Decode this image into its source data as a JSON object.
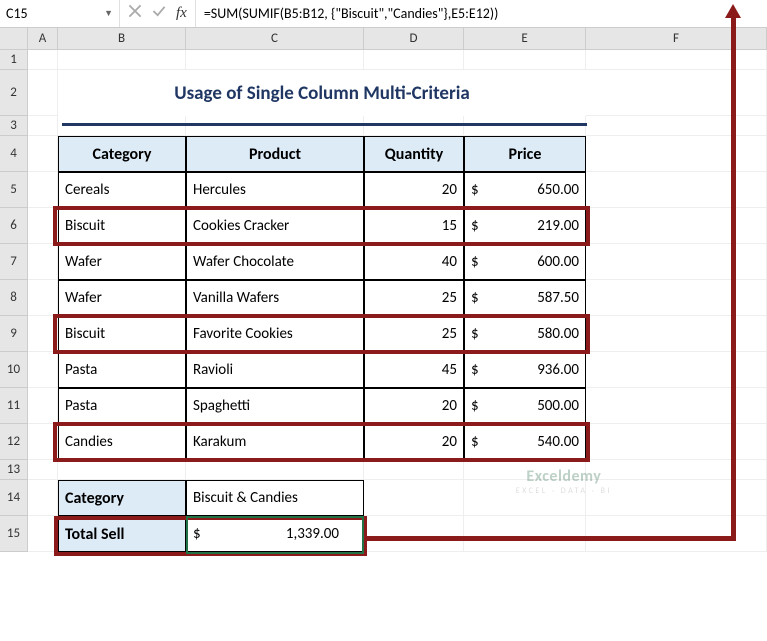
{
  "namebox": "C15",
  "formula": "=SUM(SUMIF(B5:B12, {\"Biscuit\",\"Candies\"},E5:E12))",
  "cols": [
    "A",
    "B",
    "C",
    "D",
    "E",
    "F"
  ],
  "rows": [
    "1",
    "2",
    "3",
    "4",
    "5",
    "6",
    "7",
    "8",
    "9",
    "10",
    "11",
    "12",
    "13",
    "14",
    "15"
  ],
  "title": "Usage of Single Column Multi-Criteria",
  "headers": {
    "cat": "Category",
    "prod": "Product",
    "qty": "Quantity",
    "price": "Price"
  },
  "data": [
    {
      "cat": "Cereals",
      "prod": "Hercules",
      "qty": "20",
      "cur": "$",
      "price": "650.00"
    },
    {
      "cat": "Biscuit",
      "prod": "Cookies Cracker",
      "qty": "15",
      "cur": "$",
      "price": "219.00"
    },
    {
      "cat": "Wafer",
      "prod": "Wafer Chocolate",
      "qty": "40",
      "cur": "$",
      "price": "600.00"
    },
    {
      "cat": "Wafer",
      "prod": "Vanilla Wafers",
      "qty": "25",
      "cur": "$",
      "price": "587.50"
    },
    {
      "cat": "Biscuit",
      "prod": "Favorite Cookies",
      "qty": "25",
      "cur": "$",
      "price": "580.00"
    },
    {
      "cat": "Pasta",
      "prod": "Ravioli",
      "qty": "45",
      "cur": "$",
      "price": "936.00"
    },
    {
      "cat": "Pasta",
      "prod": "Spaghetti",
      "qty": "20",
      "cur": "$",
      "price": "500.00"
    },
    {
      "cat": "Candies",
      "prod": "Karakum",
      "qty": "20",
      "cur": "$",
      "price": "540.00"
    }
  ],
  "summary": {
    "catLabel": "Category",
    "catValue": "Biscuit & Candies",
    "totLabel": "Total Sell",
    "totCur": "$",
    "totValue": "1,339.00"
  },
  "watermark": {
    "name": "Exceldemy",
    "tag": "EXCEL · DATA · BI"
  }
}
